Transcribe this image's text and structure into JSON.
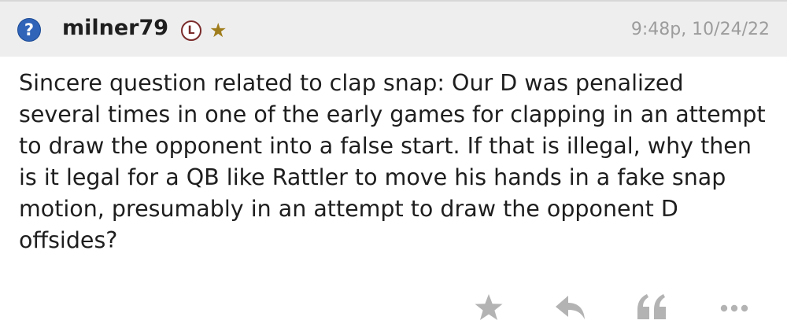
{
  "post": {
    "author": {
      "username": "milner79",
      "badge_letter": "L",
      "star_glyph": "★",
      "avatar_icon": "question-mark-icon",
      "avatar_glyph": "?"
    },
    "timestamp": "9:48p, 10/24/22",
    "body": "Sincere question related to clap snap: Our D was penalized several times in one of the early games for clapping in an attempt to draw the opponent into a false start. If that is illegal, why then is it legal for a QB like Rattler to move his hands in a fake snap motion, presumably in an attempt to draw the opponent D offsides?",
    "actions": [
      {
        "icon": "star-icon"
      },
      {
        "icon": "reply-icon"
      },
      {
        "icon": "quote-icon"
      },
      {
        "icon": "more-icon"
      }
    ]
  },
  "colors": {
    "header_bg": "#eeeeee",
    "avatar_blue": "#2f64b9",
    "badge_maroon": "#7b2b2b",
    "star_gold": "#a07d1c",
    "timestamp_gray": "#9c9c9c",
    "action_gray": "#b3b3b3",
    "text": "#1e1e1e"
  }
}
